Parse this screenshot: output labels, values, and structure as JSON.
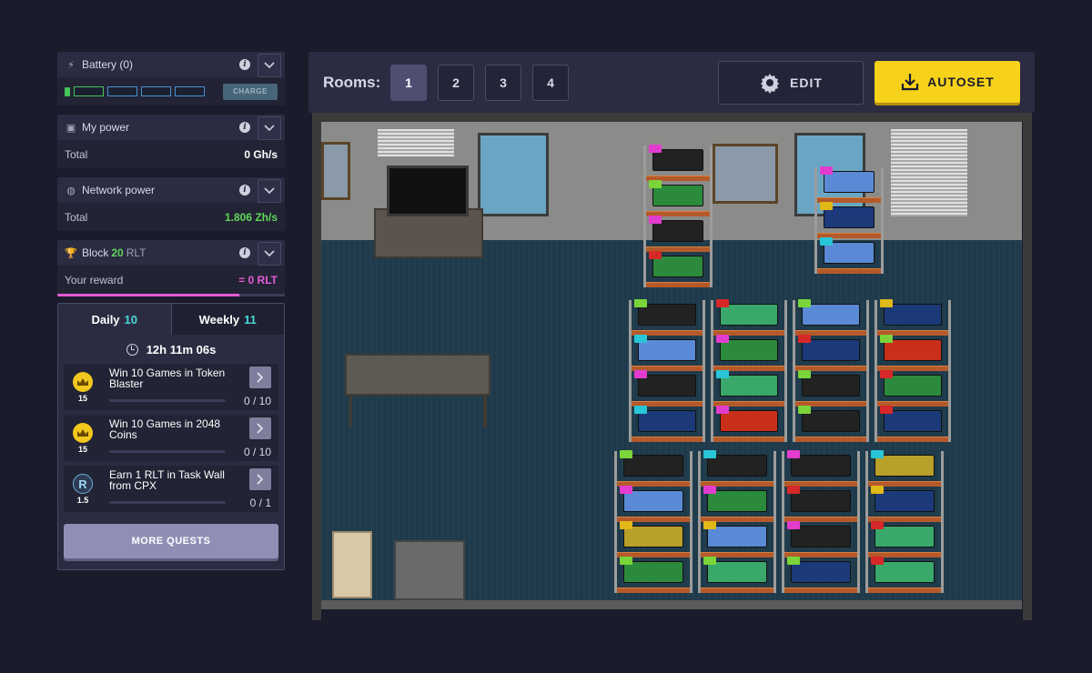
{
  "sidebar": {
    "battery": {
      "title": "Battery (0)",
      "charge_label": "CHARGE"
    },
    "my_power": {
      "title": "My power",
      "total_label": "Total",
      "total_value": "0 Gh/s"
    },
    "network_power": {
      "title": "Network power",
      "total_label": "Total",
      "total_value": "1.806 Zh/s"
    },
    "block": {
      "title": "Block",
      "number": "20",
      "currency": "RLT",
      "reward_label": "Your reward",
      "reward_value": "= 0 RLT"
    }
  },
  "quests": {
    "tabs": [
      {
        "label": "Daily",
        "count": "10"
      },
      {
        "label": "Weekly",
        "count": "11"
      }
    ],
    "timer": "12h 11m 06s",
    "items": [
      {
        "text": "Win 10 Games in Token Blaster",
        "reward": "15",
        "progress": "0 / 10"
      },
      {
        "text": "Win 10 Games in 2048 Coins",
        "reward": "15",
        "progress": "0 / 10"
      },
      {
        "text": "Earn 1 RLT in Task Wall from CPX",
        "reward": "1.5",
        "progress": "0 / 1"
      }
    ],
    "more_label": "MORE QUESTS"
  },
  "topbar": {
    "rooms_label": "Rooms:",
    "rooms": [
      "1",
      "2",
      "3",
      "4"
    ],
    "active_room": "1",
    "edit_label": "EDIT",
    "autoset_label": "AUTOSET"
  },
  "colors": {
    "accent_yellow": "#f7d21b",
    "green": "#5fd85a",
    "pink": "#e35cd8",
    "cyan": "#4ad8d8"
  }
}
